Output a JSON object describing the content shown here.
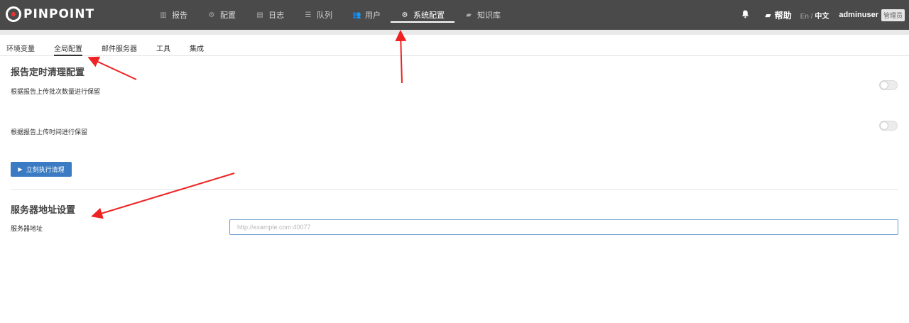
{
  "brand": {
    "name": "PINPOINT"
  },
  "nav": {
    "items": [
      {
        "label": "报告",
        "icon": "bar-chart-icon",
        "glyph": "▥"
      },
      {
        "label": "配置",
        "icon": "gear-icon",
        "glyph": "⚙"
      },
      {
        "label": "日志",
        "icon": "document-icon",
        "glyph": "▤"
      },
      {
        "label": "队列",
        "icon": "list-icon",
        "glyph": "☰"
      },
      {
        "label": "用户",
        "icon": "users-icon",
        "glyph": "👥"
      },
      {
        "label": "系统配置",
        "icon": "cog-icon",
        "glyph": "⚙",
        "active": true
      },
      {
        "label": "知识库",
        "icon": "book-icon",
        "glyph": "▰"
      }
    ],
    "help": "帮助",
    "lang_en": "En",
    "lang_sep": " / ",
    "lang_zh": "中文",
    "username": "adminuser",
    "role": "管理员"
  },
  "tabs": [
    {
      "label": "环境变量"
    },
    {
      "label": "全局配置",
      "active": true
    },
    {
      "label": "邮件服务器"
    },
    {
      "label": "工具"
    },
    {
      "label": "集成"
    }
  ],
  "cleanup": {
    "title": "报告定时清理配置",
    "by_count_label": "根据报告上传批次数量进行保留",
    "by_count_enabled": false,
    "by_time_label": "根据报告上传时间进行保留",
    "by_time_enabled": false,
    "run_button": "立刻执行清理"
  },
  "server": {
    "title": "服务器地址设置",
    "address_label": "服务器地址",
    "address_value": "",
    "address_placeholder": "http://example.com:40077"
  },
  "colors": {
    "navbar": "#4a4a4a",
    "primary_button": "#3a7bc3",
    "annotation_arrow": "#ee2222"
  }
}
